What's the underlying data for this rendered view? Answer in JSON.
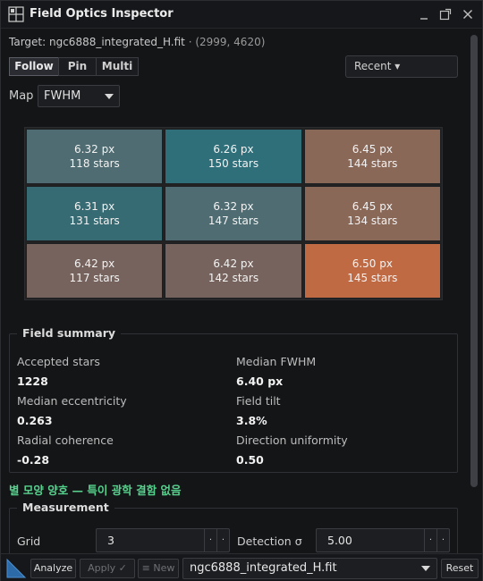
{
  "window": {
    "title": "Field Optics Inspector",
    "icons": [
      "grid-app-icon",
      "pin-icon",
      "popout-icon",
      "close-icon"
    ]
  },
  "target": {
    "prefix": "Target: ",
    "file": "ngc6888_integrated_H.fit",
    "coords": " · (2999, 4620)"
  },
  "modes": {
    "follow": "Follow",
    "pin": "Pin",
    "multi": "Multi",
    "active": "Follow"
  },
  "recent": {
    "label": "Recent ▾"
  },
  "map": {
    "label": "Map",
    "selected": "FWHM"
  },
  "grid_cells": [
    {
      "fwhm": "6.32 px",
      "stars": "118 stars",
      "color": "#4e6c71"
    },
    {
      "fwhm": "6.26 px",
      "stars": "150 stars",
      "color": "#2f6f7a"
    },
    {
      "fwhm": "6.45 px",
      "stars": "144 stars",
      "color": "#8a6858"
    },
    {
      "fwhm": "6.31 px",
      "stars": "131 stars",
      "color": "#376b73"
    },
    {
      "fwhm": "6.32 px",
      "stars": "147 stars",
      "color": "#4e6c71"
    },
    {
      "fwhm": "6.45 px",
      "stars": "134 stars",
      "color": "#8a6858"
    },
    {
      "fwhm": "6.42 px",
      "stars": "117 stars",
      "color": "#76635d"
    },
    {
      "fwhm": "6.42 px",
      "stars": "142 stars",
      "color": "#76635d"
    },
    {
      "fwhm": "6.50 px",
      "stars": "145 stars",
      "color": "#c06a44"
    }
  ],
  "summary": {
    "title": "Field summary",
    "accepted_stars_label": "Accepted stars",
    "accepted_stars_value": "1228",
    "median_fwhm_label": "Median FWHM",
    "median_fwhm_value": "6.40 px",
    "median_ecc_label": "Median eccentricity",
    "median_ecc_value": "0.263",
    "field_tilt_label": "Field tilt",
    "field_tilt_value": "3.8%",
    "radial_label": "Radial coherence",
    "radial_value": "-0.28",
    "direction_label": "Direction uniformity",
    "direction_value": "0.50"
  },
  "status": {
    "text": "별 모양 양호 — 특이 광학 결함 없음",
    "color": "#57d28e"
  },
  "measurement": {
    "title": "Measurement",
    "grid_label": "Grid",
    "grid_value": "3",
    "detection_label": "Detection σ",
    "detection_value": "5.00"
  },
  "toolbar": {
    "analyze": "Analyze",
    "apply": "Apply ✓",
    "new": "≡ New",
    "file": "ngc6888_integrated_H.fit",
    "reset": "Reset"
  }
}
